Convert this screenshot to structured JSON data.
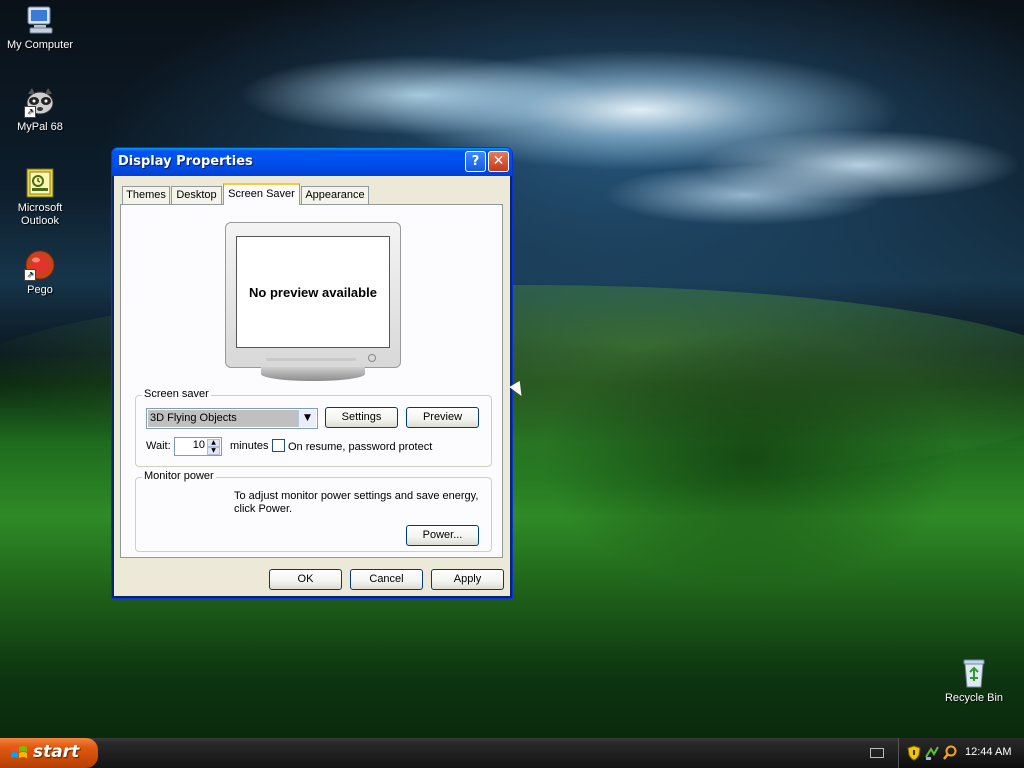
{
  "desktop": {
    "icons": [
      {
        "label": "My Computer"
      },
      {
        "label": "MyPal 68"
      },
      {
        "label": "Microsoft Outlook"
      },
      {
        "label": "Pego"
      },
      {
        "label": "Recycle Bin"
      }
    ]
  },
  "dialog": {
    "title": "Display Properties",
    "help_glyph": "?",
    "close_glyph": "✕",
    "tabs": [
      {
        "label": "Themes",
        "active": false
      },
      {
        "label": "Desktop",
        "active": false
      },
      {
        "label": "Screen Saver",
        "active": true
      },
      {
        "label": "Appearance",
        "active": false
      }
    ],
    "preview_text": "No preview available",
    "screen_saver": {
      "group_label": "Screen saver",
      "selected": "3D Flying Objects",
      "settings_label": "Settings",
      "preview_label": "Preview",
      "wait_label": "Wait:",
      "wait_value": "10",
      "minutes_label": "minutes",
      "password_label": "On resume, password protect",
      "password_checked": false
    },
    "monitor_power": {
      "group_label": "Monitor power",
      "description": "To adjust monitor power settings and save energy, click Power.",
      "power_label": "Power..."
    },
    "buttons": {
      "ok": "OK",
      "cancel": "Cancel",
      "apply": "Apply"
    }
  },
  "taskbar": {
    "start_label": "start",
    "clock": "12:44 AM"
  }
}
